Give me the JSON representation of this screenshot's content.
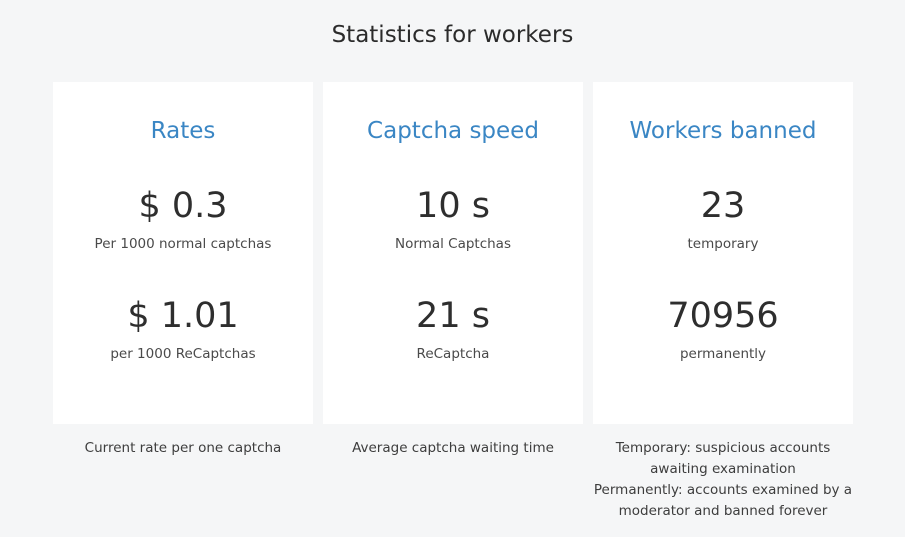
{
  "page": {
    "title": "Statistics for workers"
  },
  "cards": [
    {
      "title": "Rates",
      "stats": [
        {
          "value": "$ 0.3",
          "caption": "Per 1000 normal captchas"
        },
        {
          "value": "$ 1.01",
          "caption": "per 1000 ReCaptchas"
        }
      ],
      "footnote": [
        "Current rate per one captcha"
      ]
    },
    {
      "title": "Captcha speed",
      "stats": [
        {
          "value": "10 s",
          "caption": "Normal Captchas"
        },
        {
          "value": "21 s",
          "caption": "ReCaptcha"
        }
      ],
      "footnote": [
        "Average captcha waiting time"
      ]
    },
    {
      "title": "Workers banned",
      "stats": [
        {
          "value": "23",
          "caption": "temporary"
        },
        {
          "value": "70956",
          "caption": "permanently"
        }
      ],
      "footnote": [
        "Temporary: suspicious accounts awaiting examination",
        "Permanently: accounts examined by a moderator and banned forever"
      ]
    }
  ],
  "colors": {
    "background": "#f5f6f7",
    "card": "#ffffff",
    "accent": "#3a86c4",
    "text": "#2e2e2e"
  }
}
